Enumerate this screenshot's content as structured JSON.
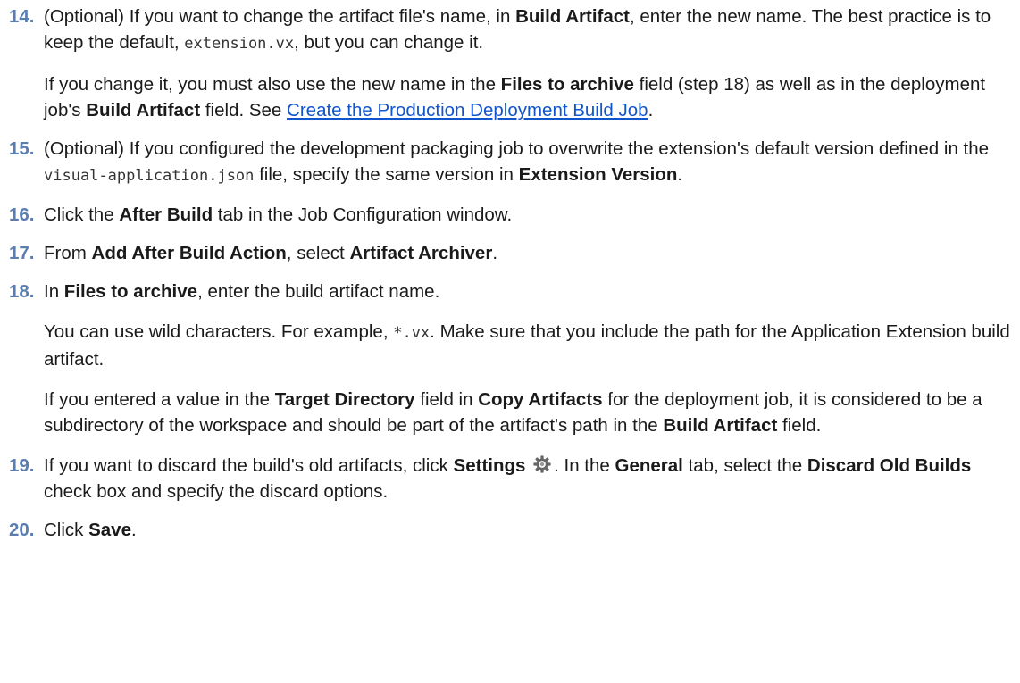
{
  "steps": [
    {
      "num": "14.",
      "p1": {
        "t1": "(Optional) If you want to change the artifact file's name, in ",
        "b1": "Build Artifact",
        "t2": ", enter the new name. The best practice is to keep the default, ",
        "c1": "extension.vx",
        "t3": ", but you can change it."
      },
      "p2": {
        "t1": "If you change it, you must also use the new name in the ",
        "b1": "Files to archive",
        "t2": " field (step 18) as well as in the deployment job's ",
        "b2": "Build Artifact",
        "t3": " field. See ",
        "link": "Create the Production Deployment Build Job",
        "t4": "."
      }
    },
    {
      "num": "15.",
      "p1": {
        "t1": "(Optional) If you configured the development packaging job to overwrite the extension's default version defined in the ",
        "c1": "visual-application.json",
        "t2": " file, specify the same version in ",
        "b1": "Extension Version",
        "t3": "."
      }
    },
    {
      "num": "16.",
      "p1": {
        "t1": "Click the ",
        "b1": "After Build",
        "t2": " tab in the Job Configuration window."
      }
    },
    {
      "num": "17.",
      "p1": {
        "t1": "From ",
        "b1": "Add After Build Action",
        "t2": ", select ",
        "b2": "Artifact Archiver",
        "t3": "."
      }
    },
    {
      "num": "18.",
      "p1": {
        "t1": "In ",
        "b1": "Files to archive",
        "t2": ", enter the build artifact name."
      },
      "p2": {
        "t1": "You can use wild characters. For example, ",
        "c1": "*.vx",
        "t2": ". Make sure that you include the path for the Application Extension build artifact."
      },
      "p3": {
        "t1": "If you entered a value in the ",
        "b1": "Target Directory",
        "t2": " field in ",
        "b2": "Copy Artifacts",
        "t3": " for the deployment job, it is considered to be a subdirectory of the workspace and should be part of the artifact's path in the ",
        "b3": "Build Artifact",
        "t4": " field."
      }
    },
    {
      "num": "19.",
      "p1": {
        "t1": "If you want to discard the build's old artifacts, click ",
        "b1": "Settings",
        "icon": "gear-icon",
        "t2": ". In the ",
        "b2": "General",
        "t3": " tab, select the ",
        "b3": "Discard Old Builds",
        "t4": " check box and specify the discard options."
      }
    },
    {
      "num": "20.",
      "p1": {
        "t1": "Click ",
        "b1": "Save",
        "t2": "."
      }
    }
  ],
  "colors": {
    "step_number": "#5b7eb0",
    "link": "#1155cc",
    "text": "#1a1a1a"
  }
}
